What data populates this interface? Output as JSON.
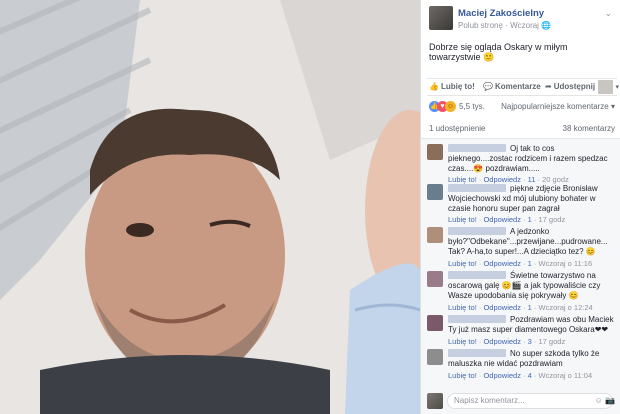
{
  "post": {
    "author": "Maciej Zakościelny",
    "like_page": "Polub stronę",
    "dot": "·",
    "time": "Wczoraj",
    "privacy_glyph": "🌐",
    "chevron_glyph": "⌄",
    "text": "Dobrze się ogląda Oskary w miłym towarzystwie 🙂"
  },
  "actions": {
    "like": "Lubię to!",
    "comment": "Komentarze",
    "share": "Udostępnij",
    "like_glyph": "👍",
    "comment_glyph": "💬",
    "share_glyph": "➦",
    "caret_glyph": "▾"
  },
  "reactions": {
    "count": "5,5 tys.",
    "sort": "Najpopularniejsze komentarze ▾",
    "like_glyph": "👍",
    "love_glyph": "♥",
    "haha_glyph": "☺"
  },
  "counts": {
    "shares": "1 udostępnienie",
    "comments": "38 komentarzy"
  },
  "comments": [
    {
      "text": "Oj tak to cos pieknego....zostac rodzicem i razem spedzac czas....😍 pozdrawiam.....",
      "like": "Lubię to!",
      "reply": "Odpowiedz",
      "likes": "11",
      "time": "20 godz",
      "avatar_color": "#8a6d5a"
    },
    {
      "text": "piękne zdjęcie Bronisław Wojciechowski xd mój ulubiony bohater w czasie honoru super pan zagrał",
      "like": "Lubię to!",
      "reply": "Odpowiedz",
      "likes": "1",
      "time": "17 godz",
      "avatar_color": "#6a7d8c"
    },
    {
      "text": "A jedzonko było?\"Odbekane\"...przewijane...pudrowane... Tak? A-ha,to super!...A dzieciątko tez? 😊",
      "like": "Lubię to!",
      "reply": "Odpowiedz",
      "likes": "1",
      "time": "Wczoraj o 11:16",
      "avatar_color": "#b08f7a"
    },
    {
      "text": "Świetne towarzystwo na oscarową galę 😊🎬 a jak typowaliście czy Wasze upodobania się pokrywały 😊",
      "like": "Lubię to!",
      "reply": "Odpowiedz",
      "likes": "1",
      "time": "Wczoraj o 12:24",
      "avatar_color": "#9a7b8a"
    },
    {
      "text": "Pozdrawiam was obu Maciek Ty już masz super diamentowego Oskara❤❤",
      "like": "Lubię to!",
      "reply": "Odpowiedz",
      "likes": "3",
      "time": "17 godz",
      "avatar_color": "#7a5a6a"
    },
    {
      "text": "No super szkoda tylko że maluszka nie widać pozdrawiam",
      "like": "Lubię to!",
      "reply": "Odpowiedz",
      "likes": "4",
      "time": "Wczoraj o 11:04",
      "avatar_color": "#8d8d8d"
    }
  ],
  "compose": {
    "placeholder": "Napisz komentarz...",
    "icons": "☺ 📷"
  }
}
